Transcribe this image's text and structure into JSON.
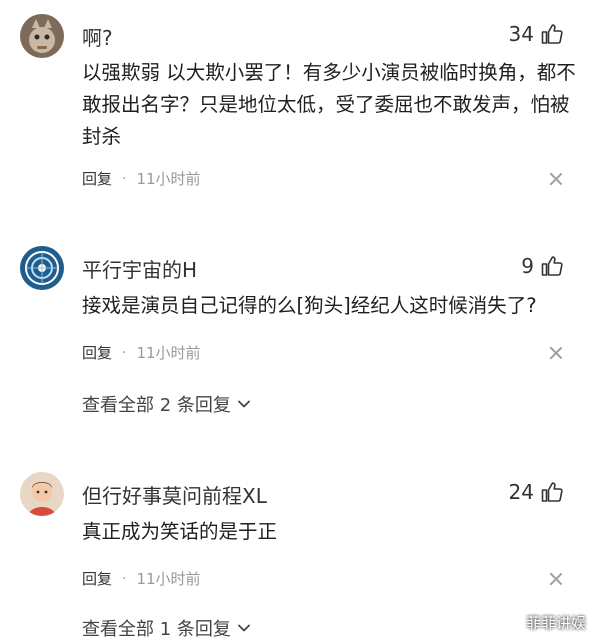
{
  "comments": [
    {
      "username": "啊?",
      "likes": "34",
      "text": "以强欺弱 以大欺小罢了！有多少小演员被临时换角，都不敢报出名字？只是地位太低，受了委屈也不敢发声，怕被封杀",
      "reply_label": "回复",
      "separator": "·",
      "time": "11小时前"
    },
    {
      "username": "平行宇宙的H",
      "likes": "9",
      "text": "接戏是演员自己记得的么[狗头]经纪人这时候消失了?",
      "reply_label": "回复",
      "separator": "·",
      "time": "11小时前",
      "view_all": "查看全部 2 条回复"
    },
    {
      "username": "但行好事莫问前程XL",
      "likes": "24",
      "text": "真正成为笑话的是于正",
      "reply_label": "回复",
      "separator": "·",
      "time": "11小时前",
      "view_all": "查看全部 1 条回复"
    }
  ],
  "watermark": "菲菲讲娱",
  "icons": {
    "like": "thumbs-up-icon",
    "close": "close-icon",
    "expand": "chevron-down-icon"
  }
}
